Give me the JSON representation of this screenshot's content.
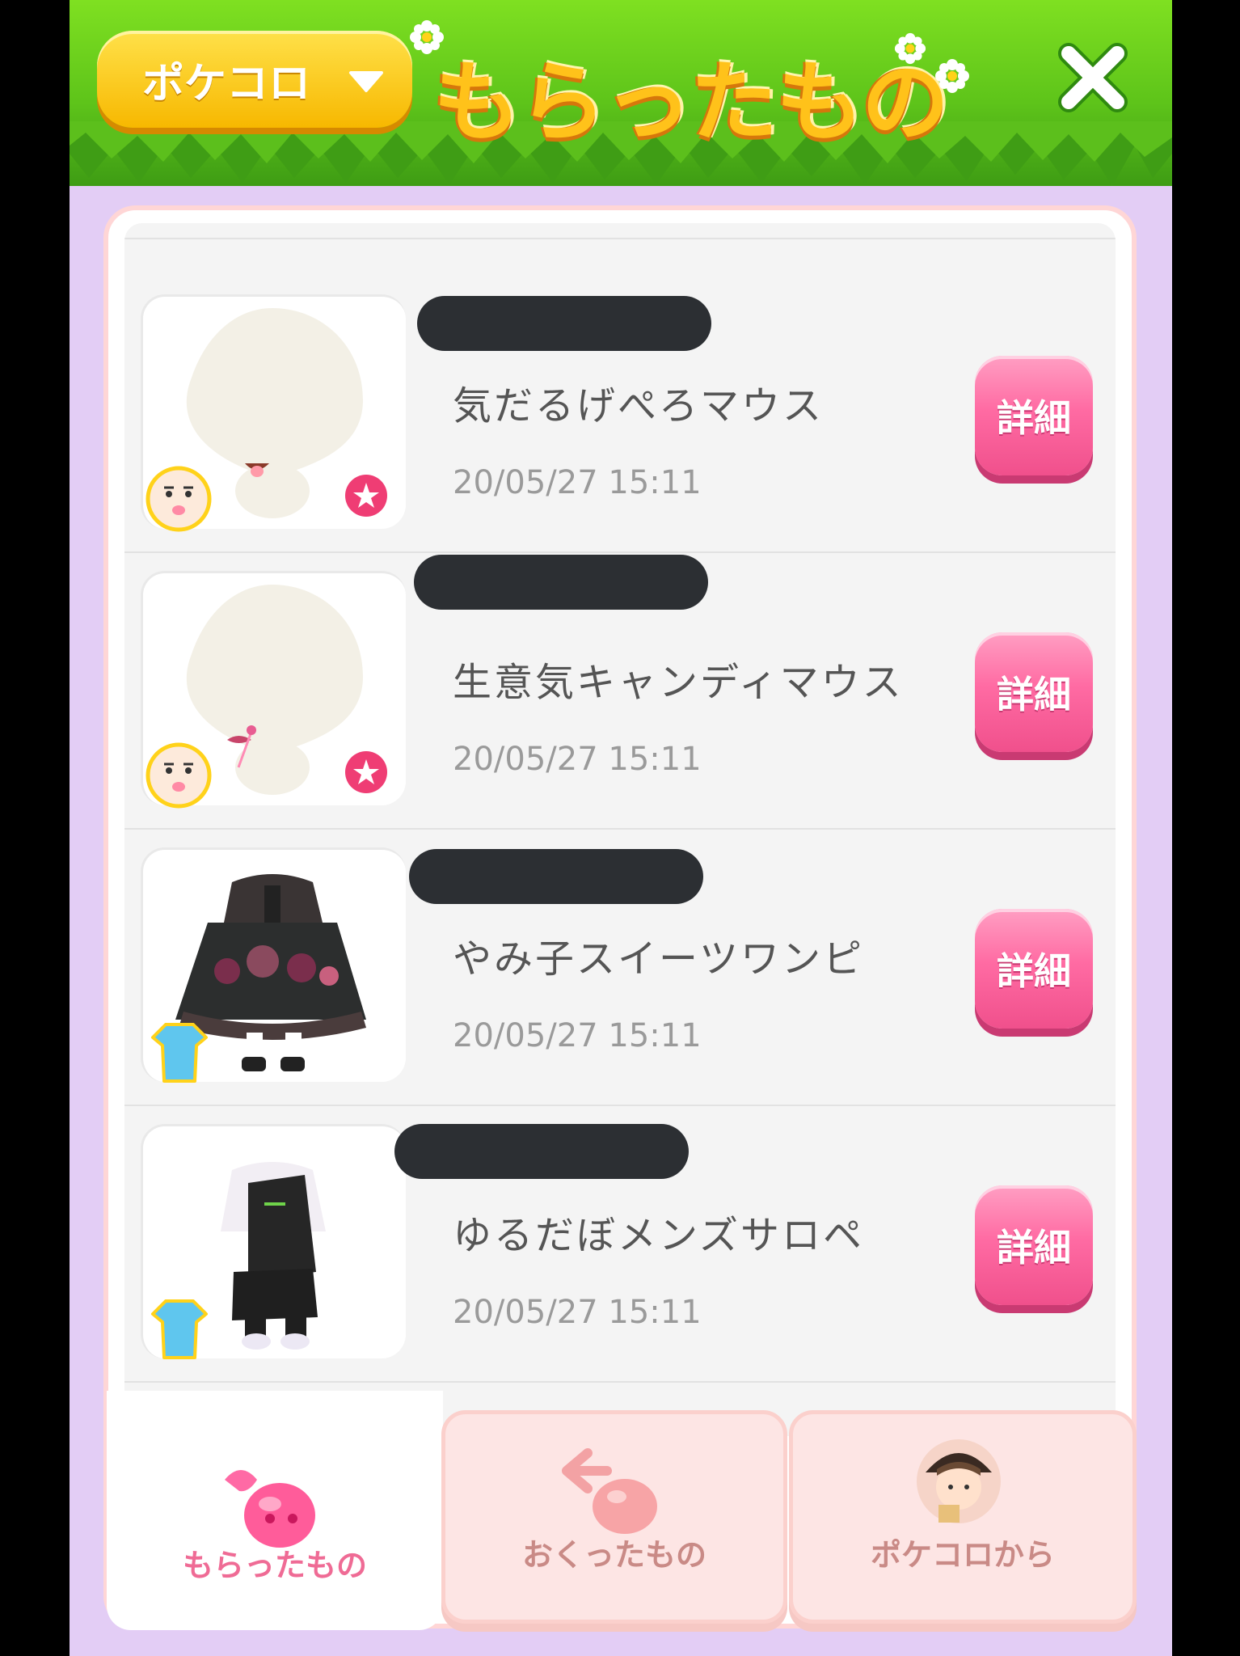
{
  "header": {
    "dropdown_label": "ポケコロ",
    "title": "もらったもの",
    "close_icon": "close-icon"
  },
  "items": [
    {
      "name": "気だるげぺろマウス",
      "date": "20/05/27 15:11",
      "detail_label": "詳細",
      "category_icon": "avatar-face-icon",
      "favorite_icon": "star-icon"
    },
    {
      "name": "生意気キャンディマウス",
      "date": "20/05/27 15:11",
      "detail_label": "詳細",
      "category_icon": "avatar-face-icon",
      "favorite_icon": "star-icon"
    },
    {
      "name": "やみ子スイーツワンピ",
      "date": "20/05/27 15:11",
      "detail_label": "詳細",
      "category_icon": "clothing-icon"
    },
    {
      "name": "ゆるだぼメンズサロペ",
      "date": "20/05/27 15:11",
      "detail_label": "詳細",
      "category_icon": "clothing-icon"
    }
  ],
  "tabs": [
    {
      "label": "もらったもの",
      "icon": "gift-received-icon",
      "active": true
    },
    {
      "label": "おくったもの",
      "icon": "gift-sent-icon",
      "active": false
    },
    {
      "label": "ポケコロから",
      "icon": "pokekoro-avatar-icon",
      "active": false
    }
  ],
  "colors": {
    "header_green": "#6fd31d",
    "background_lavender": "#e3cdf5",
    "button_pink": "#ff6ba3",
    "title_yellow": "#ffc21a"
  }
}
